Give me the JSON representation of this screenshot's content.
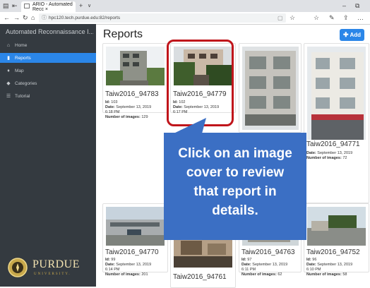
{
  "browser": {
    "tab_title": "ARIO - Automated Recc ×",
    "url": "hpc120.tech.purdue.edu:82/reports"
  },
  "sidebar": {
    "brand": "Automated Reconnaissance I...",
    "items": [
      {
        "label": "Home",
        "icon": "home-icon"
      },
      {
        "label": "Reports",
        "icon": "file-icon",
        "active": true
      },
      {
        "label": "Map",
        "icon": "map-marker-icon"
      },
      {
        "label": "Categories",
        "icon": "tag-icon"
      },
      {
        "label": "Tutorial",
        "icon": "list-icon"
      }
    ],
    "logo_text": "PURDUE",
    "logo_subtext": "UNIVERSITY."
  },
  "main": {
    "title": "Reports",
    "add_label": "Add",
    "labels": {
      "id": "Id:",
      "date": "Date:",
      "images": "Number of images:"
    },
    "reports": [
      {
        "name": "Taiw2016_94783",
        "id": "103",
        "date": "September 13, 2019",
        "time": "6:18 PM",
        "images": "129"
      },
      {
        "name": "Taiw2016_94779",
        "id": "102",
        "date": "September 13, 2019",
        "time": "6:17 PM",
        "images": ""
      },
      {
        "name": "Taiw2016_94771",
        "id": "",
        "date": "September 13, 2019",
        "time": "",
        "images": "72"
      },
      {
        "name": "Taiw2016_94770",
        "id": "99",
        "date": "September 13, 2019",
        "time": "6:14 PM",
        "images": "201"
      },
      {
        "name": "Taiw2016_94761",
        "id": "",
        "date": "",
        "time": "",
        "images": ""
      },
      {
        "name": "Taiw2016_94763",
        "id": "97",
        "date": "September 13, 2019",
        "time": "6:11 PM",
        "images": "62"
      },
      {
        "name": "Taiw2016_94752",
        "id": "96",
        "date": "September 13, 2019",
        "time": "6:10 PM",
        "images": "58"
      }
    ]
  },
  "callout": {
    "lines": [
      "Click on an image",
      "cover to review",
      "that report in",
      "details."
    ]
  },
  "colors": {
    "accent": "#2b86e8",
    "sidebar": "#343a40",
    "callout": "#3b6fc4",
    "highlight": "#c0151b"
  }
}
